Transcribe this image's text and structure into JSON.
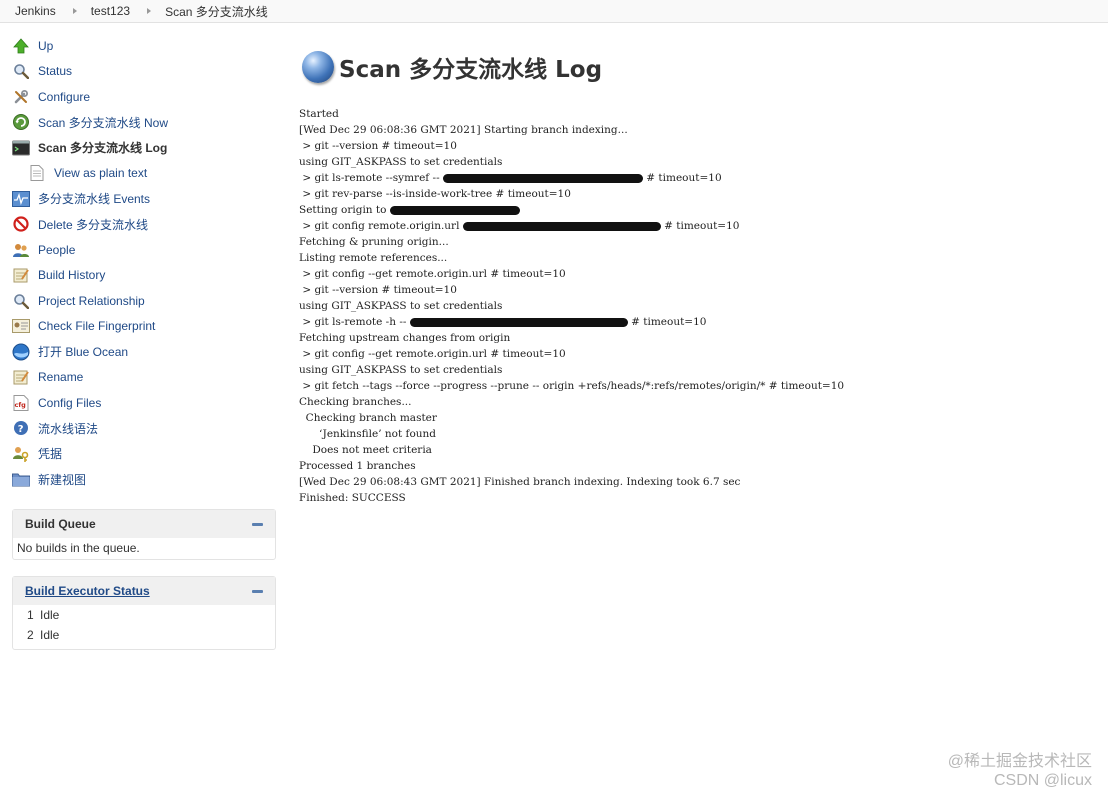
{
  "breadcrumb": {
    "items": [
      "Jenkins",
      "test123",
      "Scan 多分支流水线"
    ]
  },
  "sidebar": {
    "items": [
      {
        "label": "Up",
        "icon": "up-arrow-icon"
      },
      {
        "label": "Status",
        "icon": "magnifier-icon"
      },
      {
        "label": "Configure",
        "icon": "wrench-icon"
      },
      {
        "label": "Scan 多分支流水线 Now",
        "icon": "refresh-icon"
      },
      {
        "label": "Scan 多分支流水线 Log",
        "icon": "terminal-icon",
        "active": true
      },
      {
        "label": "View as plain text",
        "icon": "document-icon",
        "sub": true
      },
      {
        "label": "多分支流水线 Events",
        "icon": "events-icon"
      },
      {
        "label": "Delete 多分支流水线",
        "icon": "no-entry-icon"
      },
      {
        "label": "People",
        "icon": "people-icon"
      },
      {
        "label": "Build History",
        "icon": "notepad-icon"
      },
      {
        "label": "Project Relationship",
        "icon": "magnifier-icon"
      },
      {
        "label": "Check File Fingerprint",
        "icon": "fingerprint-card-icon"
      },
      {
        "label": "打开 Blue Ocean",
        "icon": "blue-ocean-icon"
      },
      {
        "label": "Rename",
        "icon": "notepad-icon"
      },
      {
        "label": "Config Files",
        "icon": "cfg-file-icon"
      },
      {
        "label": "流水线语法",
        "icon": "help-icon"
      },
      {
        "label": "凭据",
        "icon": "credentials-icon"
      },
      {
        "label": "新建视图",
        "icon": "folder-icon"
      }
    ]
  },
  "build_queue": {
    "title": "Build Queue",
    "empty_text": "No builds in the queue."
  },
  "executors": {
    "title": "Build Executor Status",
    "rows": [
      {
        "num": "1",
        "status": "Idle"
      },
      {
        "num": "2",
        "status": "Idle"
      }
    ]
  },
  "main": {
    "title": "Scan 多分支流水线 Log",
    "log": [
      {
        "text": "Started"
      },
      {
        "text": "[Wed Dec 29 06:08:36 GMT 2021] Starting branch indexing..."
      },
      {
        "text": " > git --version # timeout=10"
      },
      {
        "text": "using GIT_ASKPASS to set credentials"
      },
      {
        "text": " > git ls-remote --symref -- ",
        "redact": 200,
        "tail": " # timeout=10"
      },
      {
        "text": " > git rev-parse --is-inside-work-tree # timeout=10"
      },
      {
        "text": "Setting origin to ",
        "redact": 130,
        "tail": ""
      },
      {
        "text": " > git config remote.origin.url ",
        "redact": 198,
        "tail": " # timeout=10"
      },
      {
        "text": "Fetching & pruning origin..."
      },
      {
        "text": "Listing remote references..."
      },
      {
        "text": " > git config --get remote.origin.url # timeout=10"
      },
      {
        "text": " > git --version # timeout=10"
      },
      {
        "text": "using GIT_ASKPASS to set credentials"
      },
      {
        "text": " > git ls-remote -h -- ",
        "redact": 218,
        "tail": " # timeout=10"
      },
      {
        "text": "Fetching upstream changes from origin"
      },
      {
        "text": " > git config --get remote.origin.url # timeout=10"
      },
      {
        "text": "using GIT_ASKPASS to set credentials"
      },
      {
        "text": " > git fetch --tags --force --progress --prune -- origin +refs/heads/*:refs/remotes/origin/* # timeout=10"
      },
      {
        "text": "Checking branches..."
      },
      {
        "text": "  Checking branch master"
      },
      {
        "text": "      ‘Jenkinsfile’ not found"
      },
      {
        "text": "    Does not meet criteria"
      },
      {
        "text": "Processed 1 branches"
      },
      {
        "text": "[Wed Dec 29 06:08:43 GMT 2021] Finished branch indexing. Indexing took 6.7 sec"
      },
      {
        "text": "Finished: SUCCESS"
      }
    ]
  },
  "watermark": {
    "line1": "@稀土掘金技术社区",
    "line2": "CSDN @licux"
  }
}
